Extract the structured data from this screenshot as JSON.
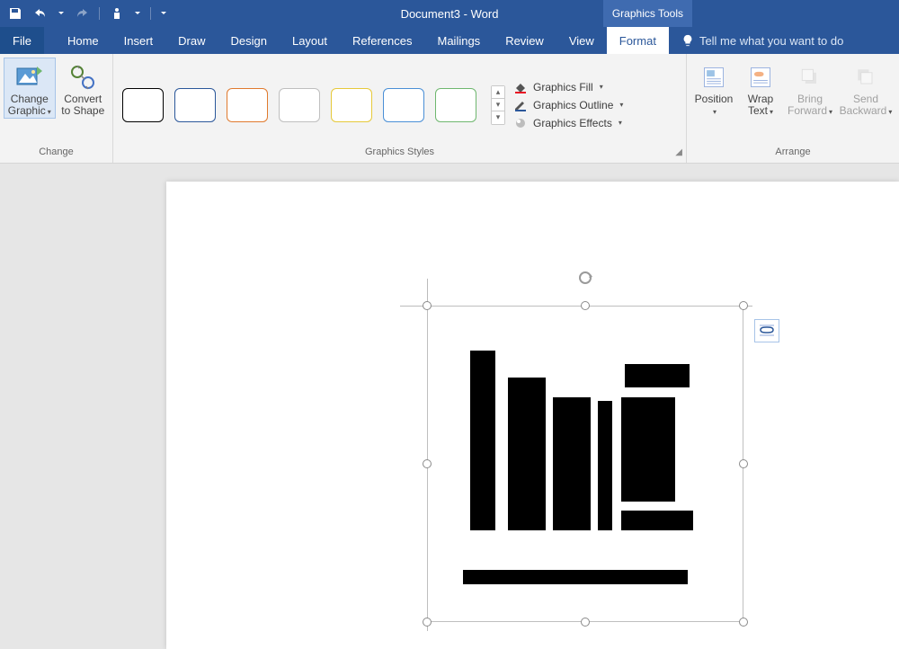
{
  "titlebar": {
    "doc_title": "Document3 - Word",
    "contextual_tab": "Graphics Tools"
  },
  "tabs": {
    "file": "File",
    "home": "Home",
    "insert": "Insert",
    "draw": "Draw",
    "design": "Design",
    "layout": "Layout",
    "references": "References",
    "mailings": "Mailings",
    "review": "Review",
    "view": "View",
    "format": "Format"
  },
  "tellme": {
    "placeholder": "Tell me what you want to do"
  },
  "ribbon": {
    "change": {
      "group_label": "Change",
      "change_graphic": "Change\nGraphic",
      "convert_to_shape": "Convert\nto Shape"
    },
    "styles": {
      "group_label": "Graphics Styles",
      "fill": "Graphics Fill",
      "outline": "Graphics Outline",
      "effects": "Graphics Effects",
      "swatch_colors": [
        "#000000",
        "#2b579a",
        "#e07a2e",
        "#bfbfbf",
        "#e6c93a",
        "#4a8fd6",
        "#6fb76f"
      ]
    },
    "arrange": {
      "group_label": "Arrange",
      "position": "Position",
      "wrap_text": "Wrap\nText",
      "bring_forward": "Bring\nForward",
      "send_backward": "Send\nBackward"
    }
  }
}
